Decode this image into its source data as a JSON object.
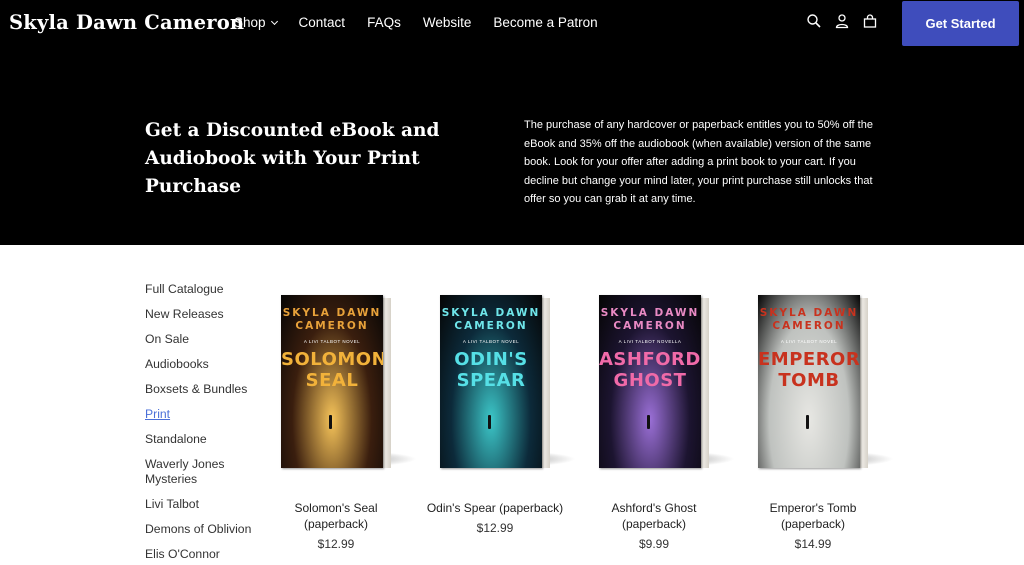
{
  "header": {
    "brand": "Skyla Dawn Cameron",
    "nav": [
      {
        "label": "Shop",
        "has_dropdown": true
      },
      {
        "label": "Contact"
      },
      {
        "label": "FAQs"
      },
      {
        "label": "Website"
      },
      {
        "label": "Become a Patron"
      }
    ],
    "icons": [
      "search-icon",
      "account-icon",
      "cart-icon"
    ],
    "cta_label": "Get Started",
    "cta_color": "#3f4dbc"
  },
  "promo": {
    "title": "Get a Discounted eBook and Audiobook with Your Print Purchase",
    "text": "The purchase of any hardcover or paperback entitles you to 50% off the eBook and 35% off the audiobook (when available) version of the same book. Look for your offer after adding a print book to your cart. If you decline but change your mind later, your print purchase still unlocks that offer so you can grab it at any time."
  },
  "sidebar": {
    "items": [
      {
        "label": "Full Catalogue"
      },
      {
        "label": "New Releases"
      },
      {
        "label": "On Sale"
      },
      {
        "label": "Audiobooks"
      },
      {
        "label": "Boxsets & Bundles"
      },
      {
        "label": "Print",
        "active": true
      },
      {
        "label": "Standalone"
      },
      {
        "label": "Waverly Jones Mysteries"
      },
      {
        "label": "Livi Talbot"
      },
      {
        "label": "Demons of Oblivion"
      },
      {
        "label": "Elis O'Connor"
      }
    ],
    "active_color": "#4a6fd8"
  },
  "products": [
    {
      "name": "Solomon's Seal (paperback)",
      "price": "$12.99",
      "cover": {
        "author": "SKYLA DAWN CAMERON",
        "series": "A LIVI TALBOT NOVEL",
        "title": "SOLOMON'S SEAL",
        "bg": "#3a1e0e",
        "glow": "#f6c45a",
        "title_color": "#f2b23a",
        "author_color": "#e8a23a"
      }
    },
    {
      "name": "Odin's Spear (paperback)",
      "price": "$12.99",
      "cover": {
        "author": "SKYLA DAWN CAMERON",
        "series": "A LIVI TALBOT NOVEL",
        "title": "ODIN'S SPEAR",
        "bg": "#0c2a3a",
        "glow": "#3cc6c8",
        "title_color": "#56e0e6",
        "author_color": "#6fe6ea"
      }
    },
    {
      "name": "Ashford's Ghost (paperback)",
      "price": "$9.99",
      "cover": {
        "author": "SKYLA DAWN CAMERON",
        "series": "A LIVI TALBOT NOVELLA",
        "title": "ASHFORD'S GHOST",
        "bg": "#1c1430",
        "glow": "#9a6fd6",
        "title_color": "#f06aa8",
        "author_color": "#e98ac4"
      }
    },
    {
      "name": "Emperor's Tomb (paperback)",
      "price": "$14.99",
      "cover": {
        "author": "SKYLA DAWN CAMERON",
        "series": "A LIVI TALBOT NOVEL",
        "title": "EMPEROR'S TOMB",
        "bg": "#bfc2bf",
        "glow": "#e7e7e3",
        "title_color": "#c8321e",
        "author_color": "#c8321e"
      }
    }
  ]
}
